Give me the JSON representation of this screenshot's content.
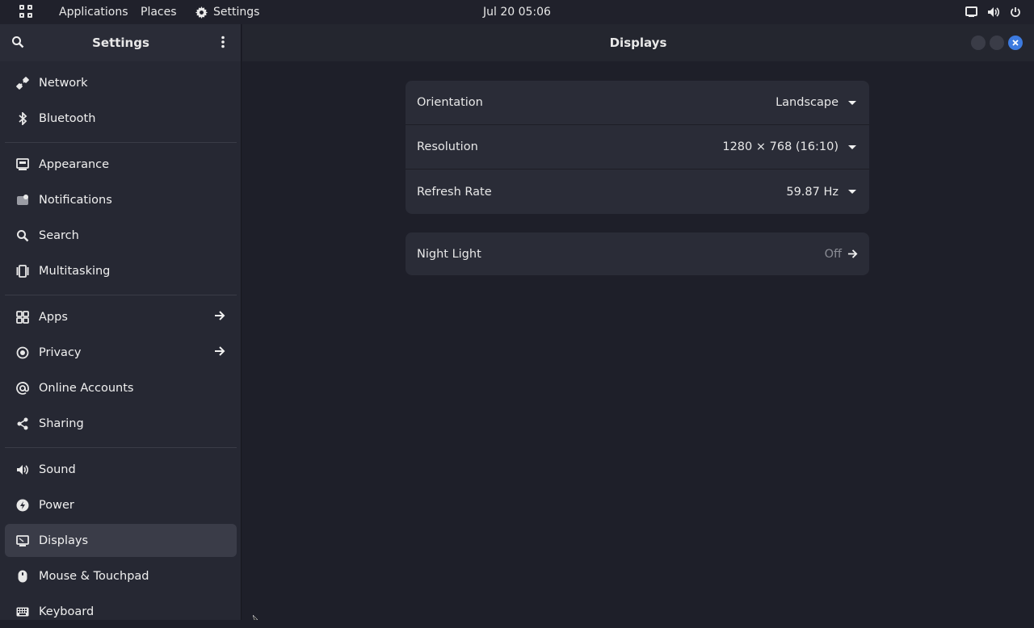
{
  "topbar": {
    "applications": "Applications",
    "places": "Places",
    "settings": "Settings",
    "clock": "Jul 20  05:06"
  },
  "sidebar": {
    "title": "Settings",
    "items": [
      {
        "label": "Network",
        "icon": "network-icon"
      },
      {
        "label": "Bluetooth",
        "icon": "bluetooth-icon"
      },
      {
        "label": "Appearance",
        "icon": "appearance-icon"
      },
      {
        "label": "Notifications",
        "icon": "notifications-icon"
      },
      {
        "label": "Search",
        "icon": "search-icon"
      },
      {
        "label": "Multitasking",
        "icon": "multitasking-icon"
      },
      {
        "label": "Apps",
        "icon": "apps-icon"
      },
      {
        "label": "Privacy",
        "icon": "privacy-icon"
      },
      {
        "label": "Online Accounts",
        "icon": "at-icon"
      },
      {
        "label": "Sharing",
        "icon": "share-icon"
      },
      {
        "label": "Sound",
        "icon": "sound-icon"
      },
      {
        "label": "Power",
        "icon": "power-icon"
      },
      {
        "label": "Displays",
        "icon": "display-icon"
      },
      {
        "label": "Mouse & Touchpad",
        "icon": "mouse-icon"
      },
      {
        "label": "Keyboard",
        "icon": "keyboard-icon"
      }
    ],
    "active": "Displays"
  },
  "main": {
    "title": "Displays",
    "display_settings": [
      {
        "label": "Orientation",
        "value": "Landscape"
      },
      {
        "label": "Resolution",
        "value": "1280 × 768 (16:10)"
      },
      {
        "label": "Refresh Rate",
        "value": "59.87 Hz"
      }
    ],
    "night_light": {
      "label": "Night Light",
      "value": "Off"
    }
  },
  "colors": {
    "accent": "#3d7be0",
    "background": "#1e1f29",
    "sidebar": "#262833",
    "card": "#2a2c37"
  }
}
